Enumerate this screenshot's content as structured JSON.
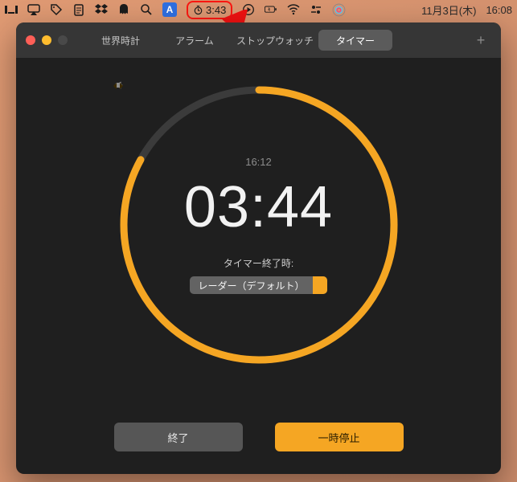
{
  "menubar": {
    "blue_badge": "A",
    "timer": "3:43",
    "date": "11月3日(木)",
    "time": "16:08"
  },
  "window": {
    "tabs": [
      {
        "label": "世界時計",
        "active": false
      },
      {
        "label": "アラーム",
        "active": false
      },
      {
        "label": "ストップウォッチ",
        "active": false
      },
      {
        "label": "タイマー",
        "active": true
      }
    ]
  },
  "timer": {
    "end_time": "16:12",
    "remaining": "03:44",
    "end_label": "タイマー終了時:",
    "sound_label": "レーダー（デフォルト）",
    "progress_fraction": 0.83
  },
  "buttons": {
    "cancel": "終了",
    "pause": "一時停止"
  },
  "colors": {
    "accent": "#f5a623",
    "track": "#3b3b3b"
  }
}
